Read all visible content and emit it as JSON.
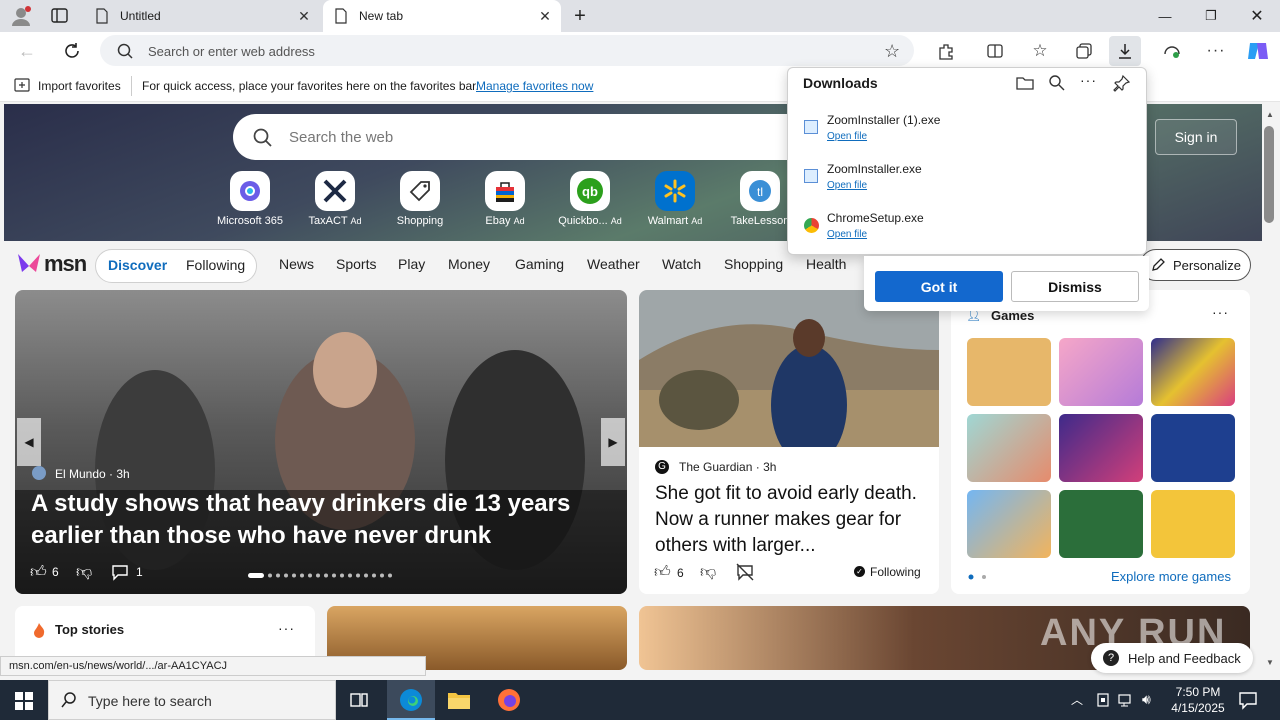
{
  "tabs": [
    {
      "label": "Untitled"
    },
    {
      "label": "New tab"
    }
  ],
  "address": {
    "placeholder": "Search or enter web address"
  },
  "favorites": {
    "import_label": "Import favorites",
    "hint": "For quick access, place your favorites here on the favorites bar.",
    "manage_link": "Manage favorites now"
  },
  "hero": {
    "search_placeholder": "Search the web",
    "sign_in": "Sign in",
    "tiles": [
      {
        "label": "Microsoft 365",
        "ad": ""
      },
      {
        "label": "TaxACT",
        "ad": "Ad"
      },
      {
        "label": "Shopping",
        "ad": ""
      },
      {
        "label": "Ebay",
        "ad": "Ad"
      },
      {
        "label": "Quickbo...",
        "ad": "Ad"
      },
      {
        "label": "Walmart",
        "ad": "Ad"
      },
      {
        "label": "TakeLesson",
        "ad": ""
      }
    ]
  },
  "downloads": {
    "title": "Downloads",
    "items": [
      {
        "name": "ZoomInstaller (1).exe",
        "action": "Open file"
      },
      {
        "name": "ZoomInstaller.exe",
        "action": "Open file"
      },
      {
        "name": "ChromeSetup.exe",
        "action": "Open file"
      }
    ],
    "got_it": "Got it",
    "dismiss": "Dismiss"
  },
  "msn": {
    "logo": "msn",
    "discover": "Discover",
    "following": "Following",
    "nav": [
      "News",
      "Sports",
      "Play",
      "Money",
      "Gaming",
      "Weather",
      "Watch",
      "Shopping",
      "Health"
    ],
    "personalize": "Personalize"
  },
  "main_story": {
    "source": "El Mundo",
    "age": "3h",
    "headline": "A study shows that heavy drinkers die 13 years earlier than those who have never drunk",
    "likes": "6",
    "comments": "1"
  },
  "side_story": {
    "source": "The Guardian",
    "age": "3h",
    "headline": "She got fit to avoid early death. Now a runner makes gear for others with larger...",
    "likes": "6",
    "following": "Following"
  },
  "games": {
    "title": "Games",
    "explore": "Explore more games"
  },
  "top_stories": {
    "title": "Top stories"
  },
  "status_url": "msn.com/en-us/news/world/.../ar-AA1CYACJ",
  "help": "Help and Feedback",
  "watermark": "ANY RUN",
  "taskbar": {
    "search_placeholder": "Type here to search",
    "time": "7:50 PM",
    "date": "4/15/2025"
  },
  "colors": {
    "accent": "#0f6cbd",
    "got_it_bg": "#1368ce"
  }
}
